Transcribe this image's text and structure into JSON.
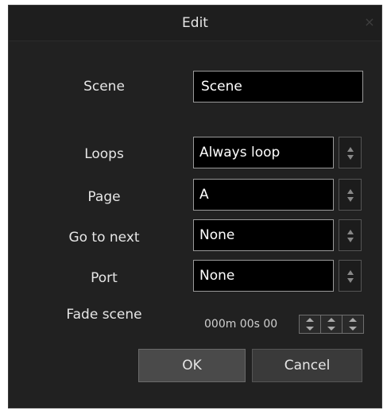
{
  "dialog": {
    "title": "Edit",
    "close_glyph": "×"
  },
  "form": {
    "scene": {
      "label": "Scene",
      "value": "Scene"
    },
    "loops": {
      "label": "Loops",
      "value": "Always loop"
    },
    "page": {
      "label": "Page",
      "value": "A"
    },
    "go_to_next": {
      "label": "Go to next",
      "value": "None"
    },
    "port": {
      "label": "Port",
      "value": "None"
    },
    "fade_scene": {
      "label": "Fade scene",
      "value": "000m 00s 00"
    }
  },
  "buttons": {
    "ok_label": "OK",
    "cancel_label": "Cancel"
  },
  "colors": {
    "background": "#212121",
    "field_background": "#000000",
    "field_border": "#9a9a9a",
    "text": "#e6e6e6"
  },
  "icons": {
    "close": "close-icon",
    "spin_arrows": "up-down-arrows-icon"
  }
}
